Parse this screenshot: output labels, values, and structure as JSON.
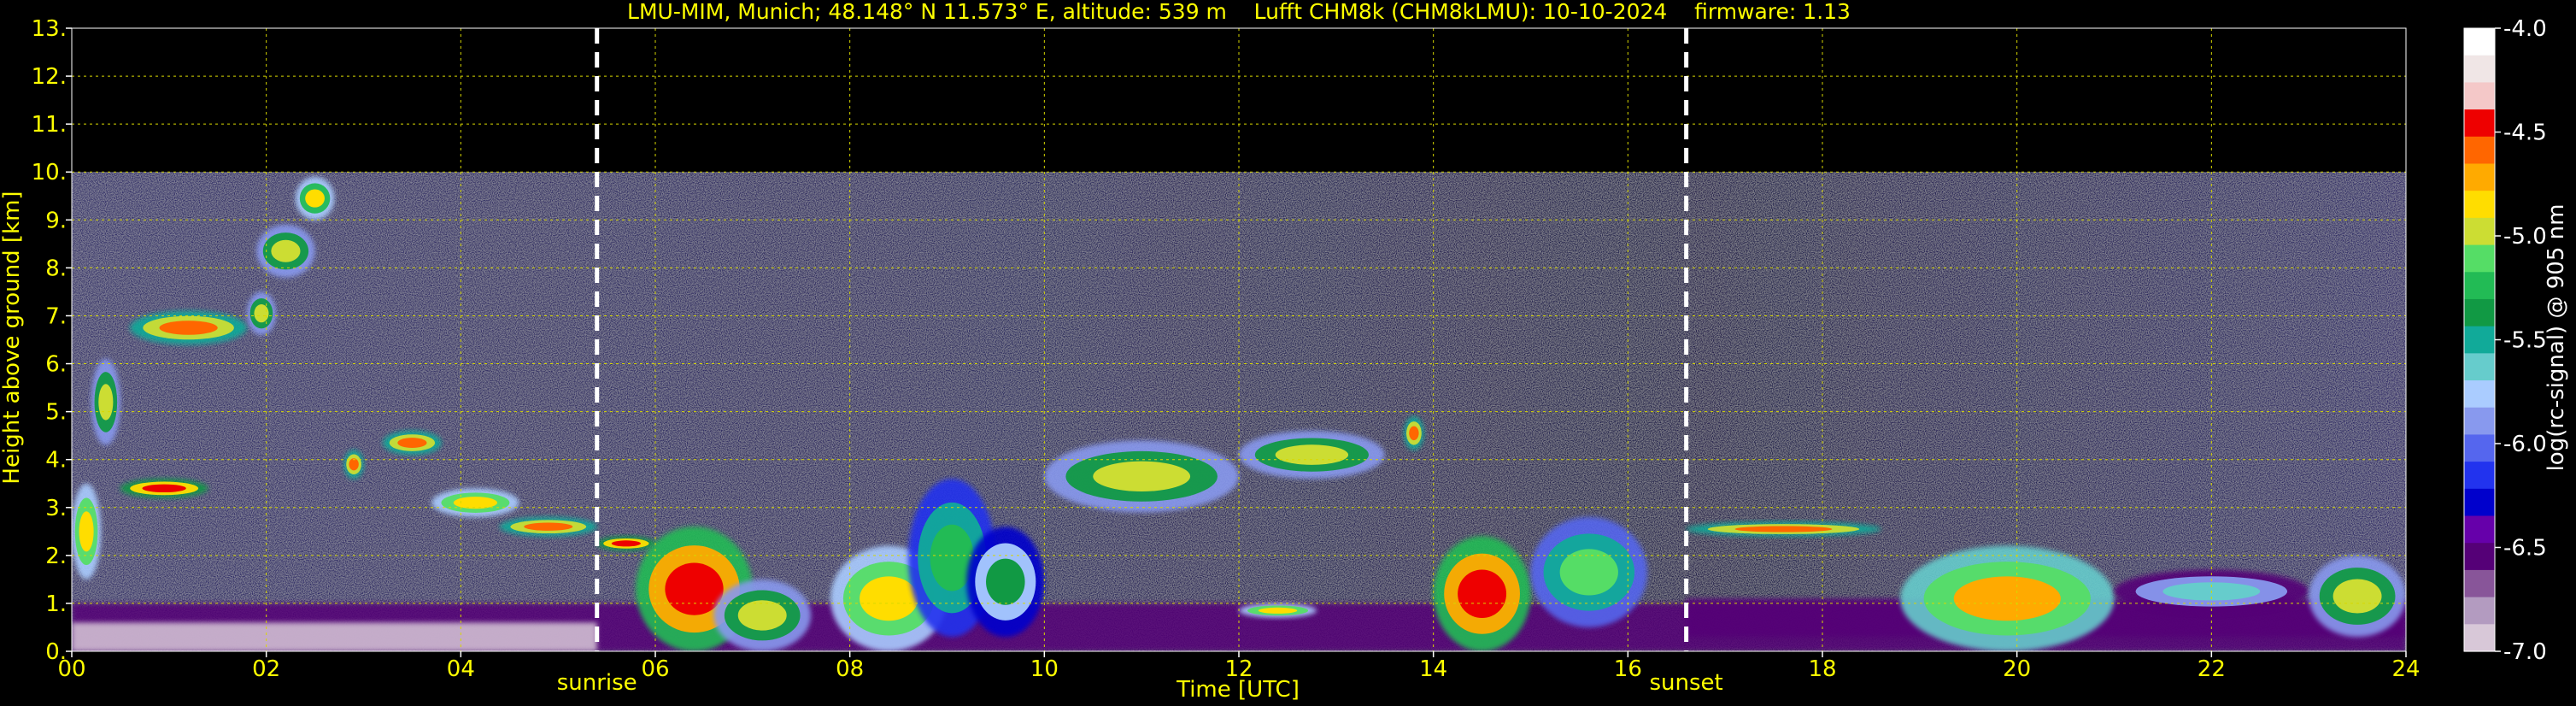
{
  "chart_data": {
    "type": "heatmap",
    "title": "LMU-MIM, Munich; 48.148° N 11.573° E, altitude: 539 m    Lufft CHM8k (CHM8kLMU): 10-10-2024    firmware: 1.13",
    "xlabel": "Time [UTC]",
    "ylabel": "Height above ground [km]",
    "xlim": [
      0,
      24
    ],
    "ylim": [
      0,
      13
    ],
    "x_ticks": [
      0,
      2,
      4,
      6,
      8,
      10,
      12,
      14,
      16,
      18,
      20,
      22,
      24
    ],
    "x_tick_labels": [
      "00",
      "02",
      "04",
      "06",
      "08",
      "10",
      "12",
      "14",
      "16",
      "18",
      "20",
      "22",
      "24"
    ],
    "y_ticks": [
      0,
      1,
      2,
      3,
      4,
      5,
      6,
      7,
      8,
      9,
      10,
      11,
      12,
      13
    ],
    "y_tick_labels": [
      "0.",
      "1.",
      "2.",
      "3.",
      "4.",
      "5.",
      "6.",
      "7.",
      "8.",
      "9.",
      "10.",
      "11.",
      "12.",
      "13."
    ],
    "grid": true,
    "data_top_km": 10,
    "annotations": [
      {
        "label": "sunrise",
        "x": 5.4
      },
      {
        "label": "sunset",
        "x": 16.6
      }
    ],
    "colorbar": {
      "label": "log(rc-signal) @ 905 nm",
      "range": [
        -7.0,
        -4.0
      ],
      "ticks": [
        -4.0,
        -4.5,
        -5.0,
        -5.5,
        -6.0,
        -6.5,
        -7.0
      ],
      "tick_labels": [
        "-4.0",
        "-4.5",
        "-5.0",
        "-5.5",
        "-6.0",
        "-6.5",
        "-7.0"
      ],
      "colors": [
        "#ffffff",
        "#f0e6e6",
        "#f4c8c8",
        "#ee0000",
        "#ff6600",
        "#ffaa00",
        "#ffdd00",
        "#ccdd33",
        "#55dd66",
        "#22bb55",
        "#119944",
        "#11aa99",
        "#66cccc",
        "#aaccff",
        "#8899ee",
        "#5566ee",
        "#2233ee",
        "#0000cc",
        "#6600aa",
        "#550077",
        "#885599",
        "#b39bc0",
        "#d8c8d8"
      ]
    },
    "layers": [
      {
        "name": "boundary-layer",
        "x": [
          0,
          24
        ],
        "y": [
          0,
          1.0
        ],
        "value": -6.6
      },
      {
        "name": "residual-night",
        "x": [
          0,
          5.4
        ],
        "y": [
          0,
          0.6
        ],
        "value": -6.9
      },
      {
        "name": "residual-evening",
        "x": [
          16.6,
          24
        ],
        "y": [
          0.3,
          1.1
        ],
        "value": -6.5
      }
    ],
    "features": [
      {
        "x": [
          0.0,
          0.3
        ],
        "y": [
          1.5,
          3.5
        ],
        "value": -4.8
      },
      {
        "x": [
          0.2,
          0.5
        ],
        "y": [
          4.3,
          6.1
        ],
        "value": -5.0
      },
      {
        "x": [
          0.5,
          1.4
        ],
        "y": [
          3.2,
          3.6
        ],
        "value": -4.5
      },
      {
        "x": [
          0.6,
          1.8
        ],
        "y": [
          6.4,
          7.1
        ],
        "value": -4.6
      },
      {
        "x": [
          1.8,
          2.1
        ],
        "y": [
          6.6,
          7.5
        ],
        "value": -5.0
      },
      {
        "x": [
          1.9,
          2.5
        ],
        "y": [
          7.8,
          8.9
        ],
        "value": -5.0
      },
      {
        "x": [
          2.3,
          2.7
        ],
        "y": [
          9.0,
          9.9
        ],
        "value": -4.9
      },
      {
        "x": [
          2.8,
          3.0
        ],
        "y": [
          3.6,
          4.2
        ],
        "value": -4.6
      },
      {
        "x": [
          3.2,
          3.8
        ],
        "y": [
          4.1,
          4.6
        ],
        "value": -4.6
      },
      {
        "x": [
          3.7,
          4.6
        ],
        "y": [
          2.8,
          3.4
        ],
        "value": -4.8
      },
      {
        "x": [
          4.4,
          5.4
        ],
        "y": [
          2.4,
          2.8
        ],
        "value": -4.6
      },
      {
        "x": [
          5.4,
          6.0
        ],
        "y": [
          2.1,
          2.4
        ],
        "value": -4.5
      },
      {
        "x": [
          5.8,
          7.0
        ],
        "y": [
          0.0,
          2.6
        ],
        "value": -4.4
      },
      {
        "x": [
          6.6,
          7.6
        ],
        "y": [
          0.0,
          1.5
        ],
        "value": -5.0
      },
      {
        "x": [
          7.8,
          9.0
        ],
        "y": [
          0.0,
          2.2
        ],
        "value": -4.8
      },
      {
        "x": [
          8.6,
          9.5
        ],
        "y": [
          0.3,
          3.6
        ],
        "value": -5.2
      },
      {
        "x": [
          9.2,
          10.0
        ],
        "y": [
          0.3,
          2.6
        ],
        "value": -5.4
      },
      {
        "x": [
          10.0,
          12.0
        ],
        "y": [
          2.9,
          4.4
        ],
        "value": -5.0
      },
      {
        "x": [
          12.0,
          13.5
        ],
        "y": [
          3.6,
          4.6
        ],
        "value": -5.0
      },
      {
        "x": [
          13.7,
          13.9
        ],
        "y": [
          4.2,
          4.9
        ],
        "value": -4.6
      },
      {
        "x": [
          12.0,
          12.8
        ],
        "y": [
          0.7,
          1.0
        ],
        "value": -4.8
      },
      {
        "x": [
          14.0,
          15.0
        ],
        "y": [
          0.0,
          2.4
        ],
        "value": -4.4
      },
      {
        "x": [
          15.0,
          16.2
        ],
        "y": [
          0.5,
          2.8
        ],
        "value": -5.1
      },
      {
        "x": [
          16.6,
          18.6
        ],
        "y": [
          2.4,
          2.7
        ],
        "value": -4.6
      },
      {
        "x": [
          18.8,
          21.0
        ],
        "y": [
          0.0,
          2.2
        ],
        "value": -4.7
      },
      {
        "x": [
          21.0,
          23.0
        ],
        "y": [
          0.8,
          1.7
        ],
        "value": -5.6
      },
      {
        "x": [
          23.0,
          24.0
        ],
        "y": [
          0.3,
          2.0
        ],
        "value": -5.0
      }
    ]
  }
}
